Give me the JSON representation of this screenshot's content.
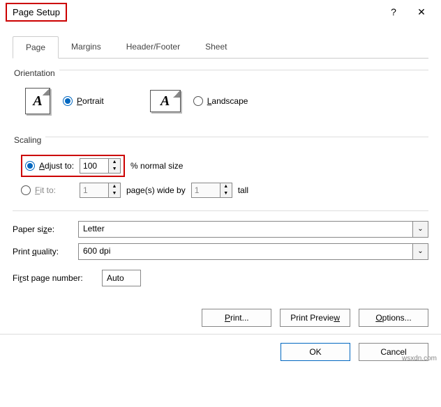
{
  "title": "Page Setup",
  "help_symbol": "?",
  "close_symbol": "✕",
  "tabs": [
    "Page",
    "Margins",
    "Header/Footer",
    "Sheet"
  ],
  "active_tab": 0,
  "orientation": {
    "label": "Orientation",
    "portrait": "Portrait",
    "landscape": "Landscape",
    "icon_letter": "A",
    "selected": "portrait"
  },
  "scaling": {
    "label": "Scaling",
    "adjust_label": "Adjust to:",
    "adjust_value": "100",
    "adjust_suffix": "% normal size",
    "fit_label": "Fit to:",
    "fit_wide_value": "1",
    "fit_mid": "page(s) wide by",
    "fit_tall_value": "1",
    "fit_tall_suffix": "tall",
    "selected": "adjust"
  },
  "paper_size": {
    "label": "Paper size:",
    "value": "Letter"
  },
  "print_quality": {
    "label": "Print quality:",
    "value": "600 dpi"
  },
  "first_page": {
    "label": "First page number:",
    "value": "Auto"
  },
  "buttons": {
    "print": "Print...",
    "preview": "Print Preview",
    "options": "Options...",
    "ok": "OK",
    "cancel": "Cancel"
  },
  "watermark": "wsxdn.com"
}
